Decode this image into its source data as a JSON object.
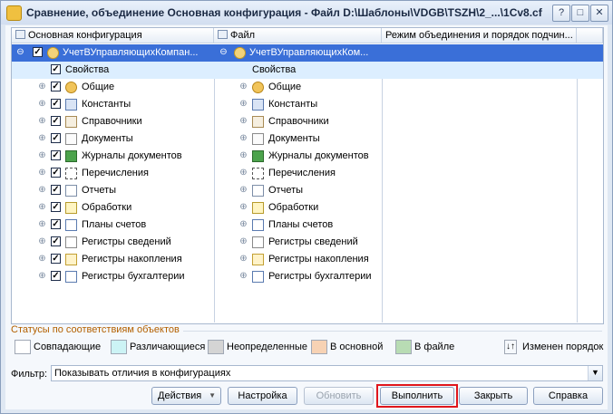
{
  "window": {
    "title": "Сравнение, объединение Основная конфигурация - Файл D:\\Шаблоны\\VDGB\\TSZH\\2_...\\1Cv8.cf"
  },
  "tree": {
    "headers": [
      "Основная конфигурация",
      "Файл",
      "Режим объединения и порядок подчин..."
    ],
    "root": {
      "left": "УчетВУправляющихКомпан...",
      "right": "УчетВУправляющихКом..."
    },
    "items": [
      {
        "label": "Свойства",
        "icon": "properties-icon"
      },
      {
        "label": "Общие",
        "icon": "common-icon"
      },
      {
        "label": "Константы",
        "icon": "constants-icon"
      },
      {
        "label": "Справочники",
        "icon": "catalogs-icon"
      },
      {
        "label": "Документы",
        "icon": "documents-icon"
      },
      {
        "label": "Журналы документов",
        "icon": "document-journals-icon"
      },
      {
        "label": "Перечисления",
        "icon": "enumerations-icon"
      },
      {
        "label": "Отчеты",
        "icon": "reports-icon"
      },
      {
        "label": "Обработки",
        "icon": "data-processors-icon"
      },
      {
        "label": "Планы счетов",
        "icon": "charts-of-accounts-icon"
      },
      {
        "label": "Регистры сведений",
        "icon": "information-registers-icon"
      },
      {
        "label": "Регистры накопления",
        "icon": "accumulation-registers-icon"
      },
      {
        "label": "Регистры бухгалтерии",
        "icon": "accounting-registers-icon"
      }
    ]
  },
  "status": {
    "title": "Статусы по соответствиям объектов",
    "legend": [
      {
        "label": "Совпадающие",
        "color": "#ffffff"
      },
      {
        "label": "Различающиеся",
        "color": "#ccf3f5"
      },
      {
        "label": "Неопределенные",
        "color": "#d4d4d4"
      },
      {
        "label": "В основной",
        "color": "#f7d2b4"
      },
      {
        "label": "В файле",
        "color": "#b8dcb4"
      }
    ],
    "order_changed": "Изменен порядок"
  },
  "filter": {
    "label": "Фильтр:",
    "value": "Показывать отличия в конфигурациях"
  },
  "buttons": {
    "actions": "Действия",
    "settings": "Настройка",
    "update": "Обновить",
    "execute": "Выполнить",
    "close": "Закрыть",
    "help": "Справка"
  }
}
